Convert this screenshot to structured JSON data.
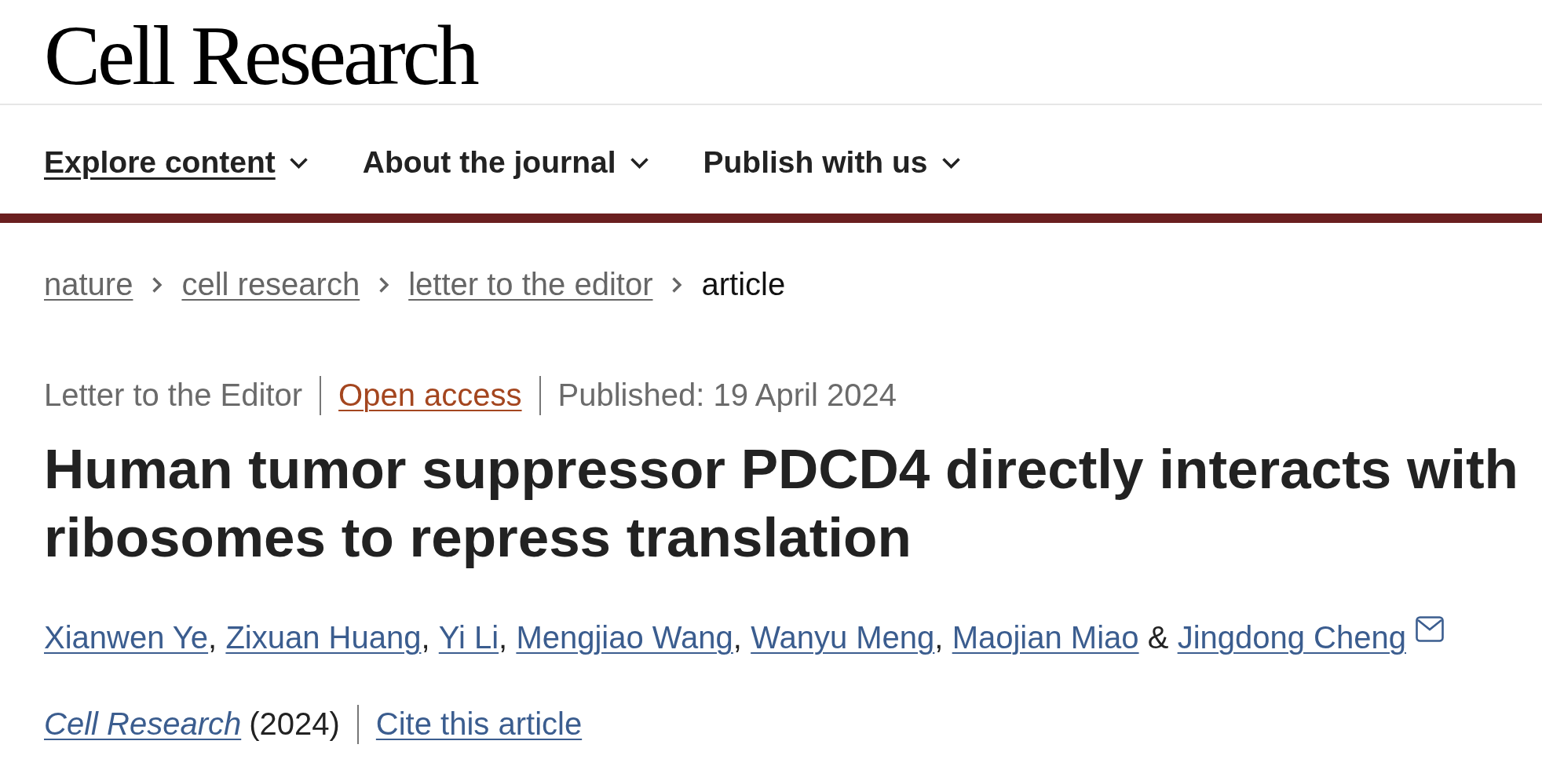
{
  "header": {
    "logo": "Cell Research"
  },
  "nav": [
    {
      "label": "Explore content",
      "selected": true
    },
    {
      "label": "About the journal",
      "selected": false
    },
    {
      "label": "Publish with us",
      "selected": false
    }
  ],
  "breadcrumbs": [
    {
      "label": "nature",
      "kind": "link"
    },
    {
      "label": "cell research",
      "kind": "link"
    },
    {
      "label": "letter to the editor",
      "kind": "link"
    },
    {
      "label": "article",
      "kind": "current"
    }
  ],
  "article": {
    "meta": [
      {
        "text": "Letter to the Editor",
        "kind": "type"
      },
      {
        "text": "Open access",
        "kind": "access"
      },
      {
        "text": "Published: 19 April 2024",
        "kind": "date"
      }
    ],
    "title": "Human tumor suppressor PDCD4 directly interacts with ribosomes to repress translation",
    "authors": [
      {
        "name": "Xianwen Ye",
        "corresponding": false,
        "separator": {
          "text": ",",
          "kind": "comma"
        }
      },
      {
        "name": "Zixuan Huang",
        "corresponding": false,
        "separator": {
          "text": ",",
          "kind": "comma"
        }
      },
      {
        "name": "Yi Li",
        "corresponding": false,
        "separator": {
          "text": ",",
          "kind": "comma"
        }
      },
      {
        "name": "Mengjiao Wang",
        "corresponding": false,
        "separator": {
          "text": ",",
          "kind": "comma"
        }
      },
      {
        "name": "Wanyu Meng",
        "corresponding": false,
        "separator": {
          "text": ",",
          "kind": "comma"
        }
      },
      {
        "name": "Maojian Miao",
        "corresponding": false,
        "separator": {
          "text": "&",
          "kind": "and"
        }
      },
      {
        "name": "Jingdong Cheng",
        "corresponding": true
      }
    ],
    "journal": "Cell Research",
    "year": "(2024)",
    "cite_link": "Cite this article"
  }
}
